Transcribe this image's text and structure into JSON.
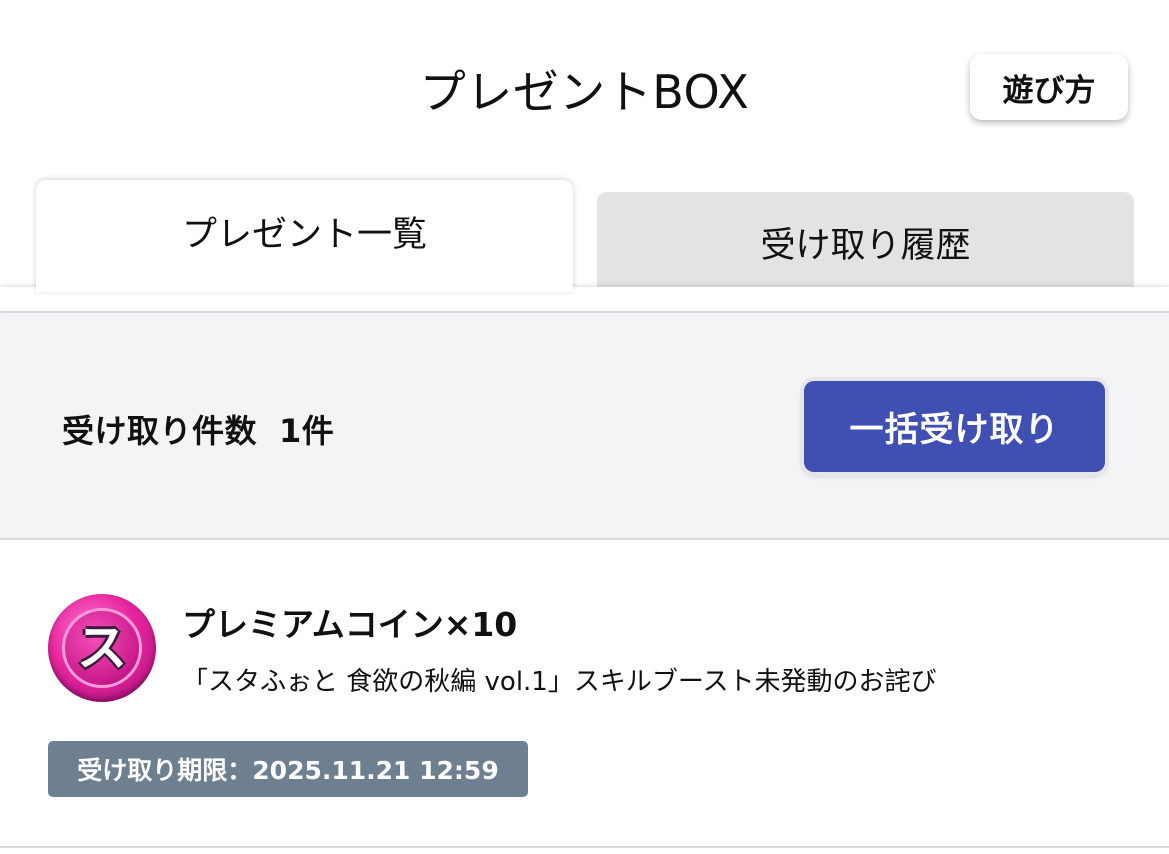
{
  "header": {
    "title": "プレゼントBOX",
    "help_label": "遊び方"
  },
  "tabs": [
    {
      "label": "プレゼント一覧",
      "active": true
    },
    {
      "label": "受け取り履歴",
      "active": false
    }
  ],
  "summary": {
    "count_label": "受け取り件数",
    "count_value": "1件",
    "bulk_receive_label": "一括受け取り"
  },
  "items": [
    {
      "icon": "premium-coin-icon",
      "icon_letter": "ス",
      "name": "プレミアムコイン×10",
      "description": "「スタふぉと 食欲の秋編 vol.1」スキルブースト未発動のお詫び",
      "deadline": "受け取り期限：2025.11.21 12:59"
    }
  ],
  "colors": {
    "accent": "#3f4fb2",
    "deadline_badge": "#6e7f90",
    "coin": "#e8269f"
  }
}
